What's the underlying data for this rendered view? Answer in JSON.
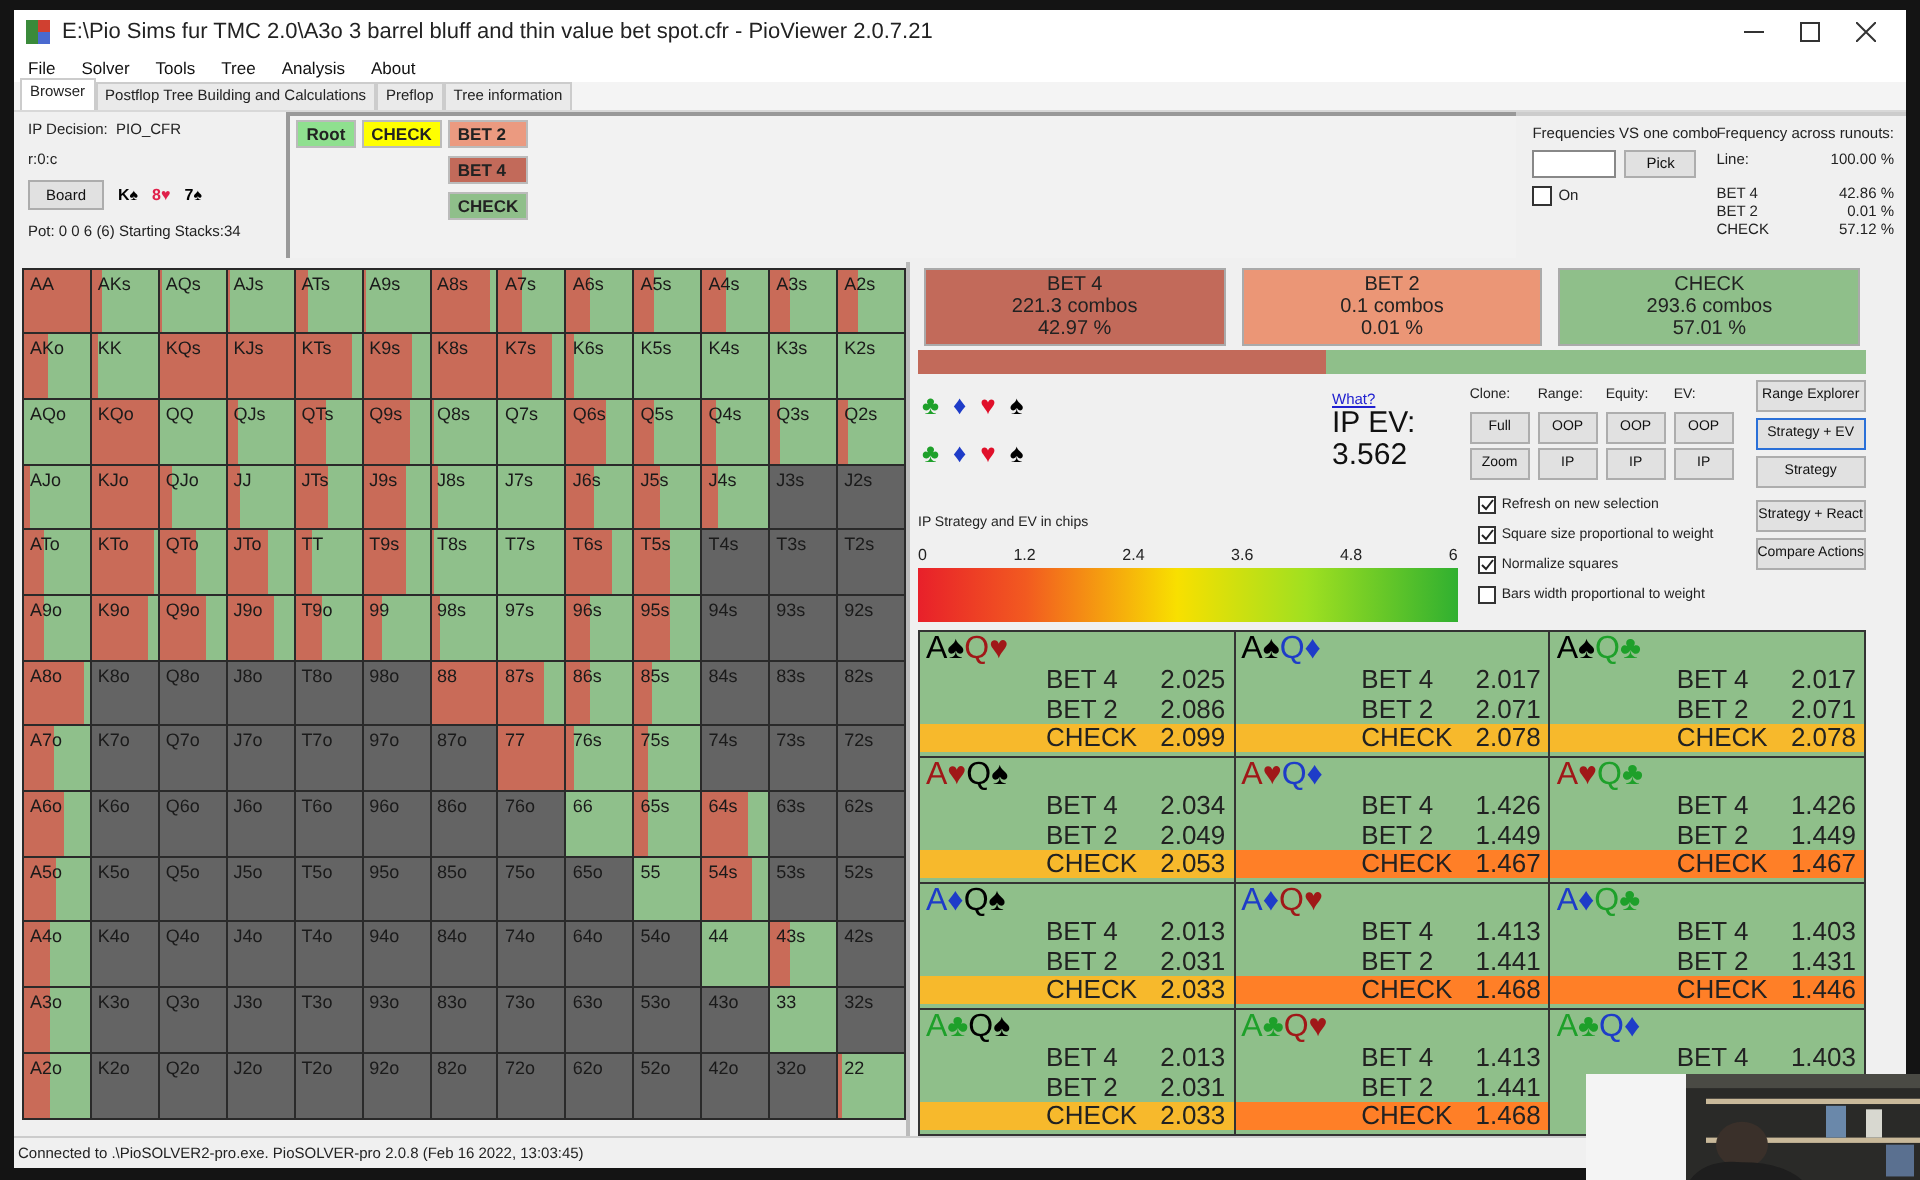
{
  "window": {
    "title": "E:\\Pio Sims fur TMC 2.0\\A3o 3 barrel bluff and thin value bet spot.cfr - PioViewer 2.0.7.21"
  },
  "menu": [
    "File",
    "Solver",
    "Tools",
    "Tree",
    "Analysis",
    "About"
  ],
  "tabs": [
    {
      "label": "Browser",
      "selected": true
    },
    {
      "label": "Postflop Tree Building and Calculations",
      "selected": false
    },
    {
      "label": "Preflop",
      "selected": false
    },
    {
      "label": "Tree information",
      "selected": false
    }
  ],
  "node_info": {
    "decision": "IP Decision:  PIO_CFR",
    "path": "r:0:c",
    "board_button": "Board",
    "pot": "Pot: 0 0 6 (6) Starting Stacks:34",
    "board": [
      {
        "rank": "K",
        "suit": "♠",
        "color": "#000000"
      },
      {
        "rank": "8",
        "suit": "♥",
        "color": "#e0204a"
      },
      {
        "rank": "7",
        "suit": "♠",
        "color": "#000000"
      }
    ]
  },
  "tree": {
    "columns": [
      {
        "nodes": [
          {
            "label": "Root",
            "color": "#8fe08f"
          }
        ]
      },
      {
        "nodes": [
          {
            "label": "CHECK",
            "color": "#ffff00"
          }
        ]
      },
      {
        "nodes": [
          {
            "label": "BET 2",
            "color": "#eb9a80"
          },
          {
            "label": "BET 4",
            "color": "#c26a5a"
          },
          {
            "label": "CHECK",
            "color": "#8fbf8a"
          }
        ]
      }
    ]
  },
  "combo_frequencies": {
    "title": "Frequencies VS one combo",
    "pick_button": "Pick",
    "on": {
      "label": "On",
      "checked": false
    }
  },
  "runout_frequencies": {
    "title": "Frequency across runouts:",
    "line": {
      "label": "Line:",
      "value": "100.00 %"
    },
    "actions": [
      {
        "label": "BET 4",
        "value": "42.86 %"
      },
      {
        "label": "BET 2",
        "value": "0.01 %"
      },
      {
        "label": "CHECK",
        "value": "57.12 %"
      }
    ]
  },
  "grid": {
    "rows": [
      {
        "cells": [
          {
            "label": "AA",
            "kind": "range",
            "level": 1
          },
          {
            "label": "AKs",
            "kind": "range",
            "level": 0.15
          },
          {
            "label": "AQs",
            "kind": "range",
            "level": 0.05
          },
          {
            "label": "AJs",
            "kind": "range",
            "level": 0.05
          },
          {
            "label": "ATs",
            "kind": "range",
            "level": 0.2
          },
          {
            "label": "A9s",
            "kind": "range",
            "level": 0.05
          },
          {
            "label": "A8s",
            "kind": "range",
            "level": 0.9
          },
          {
            "label": "A7s",
            "kind": "range",
            "level": 0.35
          },
          {
            "label": "A6s",
            "kind": "range",
            "level": 0.35
          },
          {
            "label": "A5s",
            "kind": "range",
            "level": 0.3
          },
          {
            "label": "A4s",
            "kind": "range",
            "level": 0.35
          },
          {
            "label": "A3s",
            "kind": "range",
            "level": 0.3
          },
          {
            "label": "A2s",
            "kind": "range",
            "level": 0.3
          }
        ]
      },
      {
        "cells": [
          {
            "label": "AKo",
            "kind": "range",
            "level": 0.35
          },
          {
            "label": "KK",
            "kind": "range",
            "level": 0.1
          },
          {
            "label": "KQs",
            "kind": "range",
            "level": 1
          },
          {
            "label": "KJs",
            "kind": "range",
            "level": 1
          },
          {
            "label": "KTs",
            "kind": "range",
            "level": 0.85
          },
          {
            "label": "K9s",
            "kind": "range",
            "level": 0.75
          },
          {
            "label": "K8s",
            "kind": "range",
            "level": 1
          },
          {
            "label": "K7s",
            "kind": "range",
            "level": 0.8
          },
          {
            "label": "K6s",
            "kind": "range",
            "level": 0.1
          },
          {
            "label": "K5s",
            "kind": "check"
          },
          {
            "label": "K4s",
            "kind": "check"
          },
          {
            "label": "K3s",
            "kind": "check"
          },
          {
            "label": "K2s",
            "kind": "check"
          }
        ]
      },
      {
        "cells": [
          {
            "label": "AQo",
            "kind": "check"
          },
          {
            "label": "KQo",
            "kind": "range",
            "level": 1
          },
          {
            "label": "QQ",
            "kind": "check"
          },
          {
            "label": "QJs",
            "kind": "range",
            "level": 0.15
          },
          {
            "label": "QTs",
            "kind": "range",
            "level": 0.45
          },
          {
            "label": "Q9s",
            "kind": "range",
            "level": 0.7
          },
          {
            "label": "Q8s",
            "kind": "range",
            "level": 0.05
          },
          {
            "label": "Q7s",
            "kind": "check"
          },
          {
            "label": "Q6s",
            "kind": "range",
            "level": 0.6
          },
          {
            "label": "Q5s",
            "kind": "range",
            "level": 0.3
          },
          {
            "label": "Q4s",
            "kind": "range",
            "level": 0.2
          },
          {
            "label": "Q3s",
            "kind": "range",
            "level": 0.15
          },
          {
            "label": "Q2s",
            "kind": "range",
            "level": 0.15
          }
        ]
      },
      {
        "cells": [
          {
            "label": "AJo",
            "kind": "range",
            "level": 0.1
          },
          {
            "label": "KJo",
            "kind": "range",
            "level": 1
          },
          {
            "label": "QJo",
            "kind": "range",
            "level": 0.2
          },
          {
            "label": "JJ",
            "kind": "range",
            "level": 0.2
          },
          {
            "label": "JTs",
            "kind": "range",
            "level": 0.5
          },
          {
            "label": "J9s",
            "kind": "range",
            "level": 0.65
          },
          {
            "label": "J8s",
            "kind": "range",
            "level": 0.1
          },
          {
            "label": "J7s",
            "kind": "check"
          },
          {
            "label": "J6s",
            "kind": "range",
            "level": 0.4
          },
          {
            "label": "J5s",
            "kind": "range",
            "level": 0.4
          },
          {
            "label": "J4s",
            "kind": "range",
            "level": 0.25
          },
          {
            "label": "J3s",
            "kind": "empty"
          },
          {
            "label": "J2s",
            "kind": "empty"
          }
        ]
      },
      {
        "cells": [
          {
            "label": "ATo",
            "kind": "range",
            "level": 0.3
          },
          {
            "label": "KTo",
            "kind": "range",
            "level": 0.95
          },
          {
            "label": "QTo",
            "kind": "range",
            "level": 0.55
          },
          {
            "label": "JTo",
            "kind": "range",
            "level": 0.6
          },
          {
            "label": "TT",
            "kind": "range",
            "level": 0.25
          },
          {
            "label": "T9s",
            "kind": "range",
            "level": 0.65
          },
          {
            "label": "T8s",
            "kind": "range",
            "level": 0.05
          },
          {
            "label": "T7s",
            "kind": "check"
          },
          {
            "label": "T6s",
            "kind": "range",
            "level": 0.7
          },
          {
            "label": "T5s",
            "kind": "range",
            "level": 0.55
          },
          {
            "label": "T4s",
            "kind": "empty"
          },
          {
            "label": "T3s",
            "kind": "empty"
          },
          {
            "label": "T2s",
            "kind": "empty"
          }
        ]
      },
      {
        "cells": [
          {
            "label": "A9o",
            "kind": "range",
            "level": 0.3
          },
          {
            "label": "K9o",
            "kind": "range",
            "level": 0.85
          },
          {
            "label": "Q9o",
            "kind": "range",
            "level": 0.7
          },
          {
            "label": "J9o",
            "kind": "range",
            "level": 0.7
          },
          {
            "label": "T9o",
            "kind": "range",
            "level": 0.4
          },
          {
            "label": "99",
            "kind": "range",
            "level": 0.3
          },
          {
            "label": "98s",
            "kind": "range",
            "level": 0.15
          },
          {
            "label": "97s",
            "kind": "check"
          },
          {
            "label": "96s",
            "kind": "range",
            "level": 0.35
          },
          {
            "label": "95s",
            "kind": "range",
            "level": 0.55
          },
          {
            "label": "94s",
            "kind": "empty"
          },
          {
            "label": "93s",
            "kind": "empty"
          },
          {
            "label": "92s",
            "kind": "empty"
          }
        ]
      },
      {
        "cells": [
          {
            "label": "A8o",
            "kind": "range",
            "level": 0.9
          },
          {
            "label": "K8o",
            "kind": "empty"
          },
          {
            "label": "Q8o",
            "kind": "empty"
          },
          {
            "label": "J8o",
            "kind": "empty"
          },
          {
            "label": "T8o",
            "kind": "empty"
          },
          {
            "label": "98o",
            "kind": "empty"
          },
          {
            "label": "88",
            "kind": "range",
            "level": 1
          },
          {
            "label": "87s",
            "kind": "range",
            "level": 0.7
          },
          {
            "label": "86s",
            "kind": "range",
            "level": 0.35
          },
          {
            "label": "85s",
            "kind": "range",
            "level": 0.25
          },
          {
            "label": "84s",
            "kind": "empty"
          },
          {
            "label": "83s",
            "kind": "empty"
          },
          {
            "label": "82s",
            "kind": "empty"
          }
        ]
      },
      {
        "cells": [
          {
            "label": "A7o",
            "kind": "range",
            "level": 0.45
          },
          {
            "label": "K7o",
            "kind": "empty"
          },
          {
            "label": "Q7o",
            "kind": "empty"
          },
          {
            "label": "J7o",
            "kind": "empty"
          },
          {
            "label": "T7o",
            "kind": "empty"
          },
          {
            "label": "97o",
            "kind": "empty"
          },
          {
            "label": "87o",
            "kind": "empty"
          },
          {
            "label": "77",
            "kind": "range",
            "level": 1
          },
          {
            "label": "76s",
            "kind": "range",
            "level": 0.1
          },
          {
            "label": "75s",
            "kind": "range",
            "level": 0.2
          },
          {
            "label": "74s",
            "kind": "empty"
          },
          {
            "label": "73s",
            "kind": "empty"
          },
          {
            "label": "72s",
            "kind": "empty"
          }
        ]
      },
      {
        "cells": [
          {
            "label": "A6o",
            "kind": "range",
            "level": 0.6
          },
          {
            "label": "K6o",
            "kind": "empty"
          },
          {
            "label": "Q6o",
            "kind": "empty"
          },
          {
            "label": "J6o",
            "kind": "empty"
          },
          {
            "label": "T6o",
            "kind": "empty"
          },
          {
            "label": "96o",
            "kind": "empty"
          },
          {
            "label": "86o",
            "kind": "empty"
          },
          {
            "label": "76o",
            "kind": "empty"
          },
          {
            "label": "66",
            "kind": "check"
          },
          {
            "label": "65s",
            "kind": "range",
            "level": 0.2
          },
          {
            "label": "64s",
            "kind": "range",
            "level": 0.7
          },
          {
            "label": "63s",
            "kind": "empty"
          },
          {
            "label": "62s",
            "kind": "empty"
          }
        ]
      },
      {
        "cells": [
          {
            "label": "A5o",
            "kind": "range",
            "level": 0.5
          },
          {
            "label": "K5o",
            "kind": "empty"
          },
          {
            "label": "Q5o",
            "kind": "empty"
          },
          {
            "label": "J5o",
            "kind": "empty"
          },
          {
            "label": "T5o",
            "kind": "empty"
          },
          {
            "label": "95o",
            "kind": "empty"
          },
          {
            "label": "85o",
            "kind": "empty"
          },
          {
            "label": "75o",
            "kind": "empty"
          },
          {
            "label": "65o",
            "kind": "empty"
          },
          {
            "label": "55",
            "kind": "check"
          },
          {
            "label": "54s",
            "kind": "range",
            "level": 0.75
          },
          {
            "label": "53s",
            "kind": "empty"
          },
          {
            "label": "52s",
            "kind": "empty"
          }
        ]
      },
      {
        "cells": [
          {
            "label": "A4o",
            "kind": "range",
            "level": 0.4
          },
          {
            "label": "K4o",
            "kind": "empty"
          },
          {
            "label": "Q4o",
            "kind": "empty"
          },
          {
            "label": "J4o",
            "kind": "empty"
          },
          {
            "label": "T4o",
            "kind": "empty"
          },
          {
            "label": "94o",
            "kind": "empty"
          },
          {
            "label": "84o",
            "kind": "empty"
          },
          {
            "label": "74o",
            "kind": "empty"
          },
          {
            "label": "64o",
            "kind": "empty"
          },
          {
            "label": "54o",
            "kind": "empty"
          },
          {
            "label": "44",
            "kind": "check"
          },
          {
            "label": "43s",
            "kind": "range",
            "level": 0.3
          },
          {
            "label": "42s",
            "kind": "empty"
          }
        ]
      },
      {
        "cells": [
          {
            "label": "A3o",
            "kind": "range",
            "level": 0.4
          },
          {
            "label": "K3o",
            "kind": "empty"
          },
          {
            "label": "Q3o",
            "kind": "empty"
          },
          {
            "label": "J3o",
            "kind": "empty"
          },
          {
            "label": "T3o",
            "kind": "empty"
          },
          {
            "label": "93o",
            "kind": "empty"
          },
          {
            "label": "83o",
            "kind": "empty"
          },
          {
            "label": "73o",
            "kind": "empty"
          },
          {
            "label": "63o",
            "kind": "empty"
          },
          {
            "label": "53o",
            "kind": "empty"
          },
          {
            "label": "43o",
            "kind": "empty"
          },
          {
            "label": "33",
            "kind": "check"
          },
          {
            "label": "32s",
            "kind": "empty"
          }
        ]
      },
      {
        "cells": [
          {
            "label": "A2o",
            "kind": "range",
            "level": 0.4
          },
          {
            "label": "K2o",
            "kind": "empty"
          },
          {
            "label": "Q2o",
            "kind": "empty"
          },
          {
            "label": "J2o",
            "kind": "empty"
          },
          {
            "label": "T2o",
            "kind": "empty"
          },
          {
            "label": "92o",
            "kind": "empty"
          },
          {
            "label": "82o",
            "kind": "empty"
          },
          {
            "label": "72o",
            "kind": "empty"
          },
          {
            "label": "62o",
            "kind": "empty"
          },
          {
            "label": "52o",
            "kind": "empty"
          },
          {
            "label": "42o",
            "kind": "empty"
          },
          {
            "label": "32o",
            "kind": "empty"
          },
          {
            "label": "22",
            "kind": "range",
            "level": 0.05
          }
        ]
      }
    ]
  },
  "summary": {
    "actions": [
      {
        "name": "BET 4",
        "combos": "221.3 combos",
        "share": "42.97 %",
        "color": "#c26a5a",
        "level": 0.4297
      },
      {
        "name": "BET 2",
        "combos": "0.1 combos",
        "share": "0.01 %",
        "color": "#eb9676",
        "level": 0.0001
      },
      {
        "name": "CHECK",
        "combos": "293.6 combos",
        "share": "57.01 %",
        "color": "#8fbf8a",
        "level": 0.5701
      }
    ]
  },
  "suit_filters": [
    {
      "suits": [
        {
          "symbol": "♣",
          "color": "#1ea02a"
        },
        {
          "symbol": "♦",
          "color": "#1e3cc8"
        },
        {
          "symbol": "♥",
          "color": "#e0102a"
        },
        {
          "symbol": "♠",
          "color": "#000000"
        }
      ]
    },
    {
      "suits": [
        {
          "symbol": "♣",
          "color": "#1ea02a"
        },
        {
          "symbol": "♦",
          "color": "#1e3cc8"
        },
        {
          "symbol": "♥",
          "color": "#e0102a"
        },
        {
          "symbol": "♠",
          "color": "#000000"
        }
      ]
    }
  ],
  "ev": {
    "link": "What?",
    "label": "IP EV:",
    "value": "3.562"
  },
  "display": {
    "columns": [
      {
        "header": "Clone:",
        "buttons": [
          "Full",
          "Zoom"
        ]
      },
      {
        "header": "Range:",
        "buttons": [
          "OOP",
          "IP"
        ]
      },
      {
        "header": "Equity:",
        "buttons": [
          "OOP",
          "IP"
        ]
      },
      {
        "header": "EV:",
        "buttons": [
          "OOP",
          "IP"
        ]
      }
    ]
  },
  "options": [
    {
      "label": "Refresh on new selection",
      "checked": true
    },
    {
      "label": "Square size proportional to weight",
      "checked": true
    },
    {
      "label": "Normalize squares",
      "checked": true
    },
    {
      "label": "Bars width proportional to weight",
      "checked": false
    }
  ],
  "views": [
    {
      "label": "Range Explorer",
      "selected": false
    },
    {
      "label": "Strategy + EV",
      "selected": true
    },
    {
      "label": "Strategy",
      "selected": false
    },
    {
      "label": "Strategy + React",
      "selected": false
    },
    {
      "label": "Compare Actions",
      "selected": false
    }
  ],
  "scale": {
    "title": "IP Strategy and EV in chips",
    "ticks": [
      "0",
      "1.2",
      "2.4",
      "3.6",
      "4.8",
      "6"
    ]
  },
  "combos": [
    {
      "cards": [
        {
          "rank": "A",
          "suit": "♠",
          "color": "#000000"
        },
        {
          "rank": "Q",
          "suit": "♥",
          "color": "#a01818"
        }
      ],
      "actions": [
        {
          "name": "BET 4",
          "value": "2.025",
          "color": "#8fbf8a"
        },
        {
          "name": "BET 2",
          "value": "2.086",
          "color": "#8fbf8a"
        },
        {
          "name": "CHECK",
          "value": "2.099",
          "color": "#f7b92c"
        }
      ]
    },
    {
      "cards": [
        {
          "rank": "A",
          "suit": "♠",
          "color": "#000000"
        },
        {
          "rank": "Q",
          "suit": "♦",
          "color": "#1e3cc8"
        }
      ],
      "actions": [
        {
          "name": "BET 4",
          "value": "2.017",
          "color": "#8fbf8a"
        },
        {
          "name": "BET 2",
          "value": "2.071",
          "color": "#8fbf8a"
        },
        {
          "name": "CHECK",
          "value": "2.078",
          "color": "#f7b92c"
        }
      ]
    },
    {
      "cards": [
        {
          "rank": "A",
          "suit": "♠",
          "color": "#000000"
        },
        {
          "rank": "Q",
          "suit": "♣",
          "color": "#1ea02a"
        }
      ],
      "actions": [
        {
          "name": "BET 4",
          "value": "2.017",
          "color": "#8fbf8a"
        },
        {
          "name": "BET 2",
          "value": "2.071",
          "color": "#8fbf8a"
        },
        {
          "name": "CHECK",
          "value": "2.078",
          "color": "#f7b92c"
        }
      ]
    },
    {
      "cards": [
        {
          "rank": "A",
          "suit": "♥",
          "color": "#a01818"
        },
        {
          "rank": "Q",
          "suit": "♠",
          "color": "#000000"
        }
      ],
      "actions": [
        {
          "name": "BET 4",
          "value": "2.034",
          "color": "#8fbf8a"
        },
        {
          "name": "BET 2",
          "value": "2.049",
          "color": "#8fbf8a"
        },
        {
          "name": "CHECK",
          "value": "2.053",
          "color": "#f7b92c"
        }
      ]
    },
    {
      "cards": [
        {
          "rank": "A",
          "suit": "♥",
          "color": "#a01818"
        },
        {
          "rank": "Q",
          "suit": "♦",
          "color": "#1e3cc8"
        }
      ],
      "actions": [
        {
          "name": "BET 4",
          "value": "1.426",
          "color": "#8fbf8a"
        },
        {
          "name": "BET 2",
          "value": "1.449",
          "color": "#8fbf8a"
        },
        {
          "name": "CHECK",
          "value": "1.467",
          "color": "#ff7f27"
        }
      ]
    },
    {
      "cards": [
        {
          "rank": "A",
          "suit": "♥",
          "color": "#a01818"
        },
        {
          "rank": "Q",
          "suit": "♣",
          "color": "#1ea02a"
        }
      ],
      "actions": [
        {
          "name": "BET 4",
          "value": "1.426",
          "color": "#8fbf8a"
        },
        {
          "name": "BET 2",
          "value": "1.449",
          "color": "#8fbf8a"
        },
        {
          "name": "CHECK",
          "value": "1.467",
          "color": "#ff7f27"
        }
      ]
    },
    {
      "cards": [
        {
          "rank": "A",
          "suit": "♦",
          "color": "#1e3cc8"
        },
        {
          "rank": "Q",
          "suit": "♠",
          "color": "#000000"
        }
      ],
      "actions": [
        {
          "name": "BET 4",
          "value": "2.013",
          "color": "#8fbf8a"
        },
        {
          "name": "BET 2",
          "value": "2.031",
          "color": "#8fbf8a"
        },
        {
          "name": "CHECK",
          "value": "2.033",
          "color": "#f7b92c"
        }
      ]
    },
    {
      "cards": [
        {
          "rank": "A",
          "suit": "♦",
          "color": "#1e3cc8"
        },
        {
          "rank": "Q",
          "suit": "♥",
          "color": "#a01818"
        }
      ],
      "actions": [
        {
          "name": "BET 4",
          "value": "1.413",
          "color": "#8fbf8a"
        },
        {
          "name": "BET 2",
          "value": "1.441",
          "color": "#8fbf8a"
        },
        {
          "name": "CHECK",
          "value": "1.468",
          "color": "#ff7f27"
        }
      ]
    },
    {
      "cards": [
        {
          "rank": "A",
          "suit": "♦",
          "color": "#1e3cc8"
        },
        {
          "rank": "Q",
          "suit": "♣",
          "color": "#1ea02a"
        }
      ],
      "actions": [
        {
          "name": "BET 4",
          "value": "1.403",
          "color": "#8fbf8a"
        },
        {
          "name": "BET 2",
          "value": "1.431",
          "color": "#8fbf8a"
        },
        {
          "name": "CHECK",
          "value": "1.446",
          "color": "#ff7f27"
        }
      ]
    },
    {
      "cards": [
        {
          "rank": "A",
          "suit": "♣",
          "color": "#1ea02a"
        },
        {
          "rank": "Q",
          "suit": "♠",
          "color": "#000000"
        }
      ],
      "actions": [
        {
          "name": "BET 4",
          "value": "2.013",
          "color": "#8fbf8a"
        },
        {
          "name": "BET 2",
          "value": "2.031",
          "color": "#8fbf8a"
        },
        {
          "name": "CHECK",
          "value": "2.033",
          "color": "#f7b92c"
        }
      ]
    },
    {
      "cards": [
        {
          "rank": "A",
          "suit": "♣",
          "color": "#1ea02a"
        },
        {
          "rank": "Q",
          "suit": "♥",
          "color": "#a01818"
        }
      ],
      "actions": [
        {
          "name": "BET 4",
          "value": "1.413",
          "color": "#8fbf8a"
        },
        {
          "name": "BET 2",
          "value": "1.441",
          "color": "#8fbf8a"
        },
        {
          "name": "CHECK",
          "value": "1.468",
          "color": "#ff7f27"
        }
      ]
    },
    {
      "cards": [
        {
          "rank": "A",
          "suit": "♣",
          "color": "#1ea02a"
        },
        {
          "rank": "Q",
          "suit": "♦",
          "color": "#1e3cc8"
        }
      ],
      "actions": [
        {
          "name": "BET 4",
          "value": "1.403",
          "color": "#8fbf8a"
        }
      ]
    }
  ],
  "status_bar": "Connected to .\\PioSOLVER2-pro.exe. PioSOLVER-pro 2.0.8 (Feb 16 2022, 13:03:45)"
}
